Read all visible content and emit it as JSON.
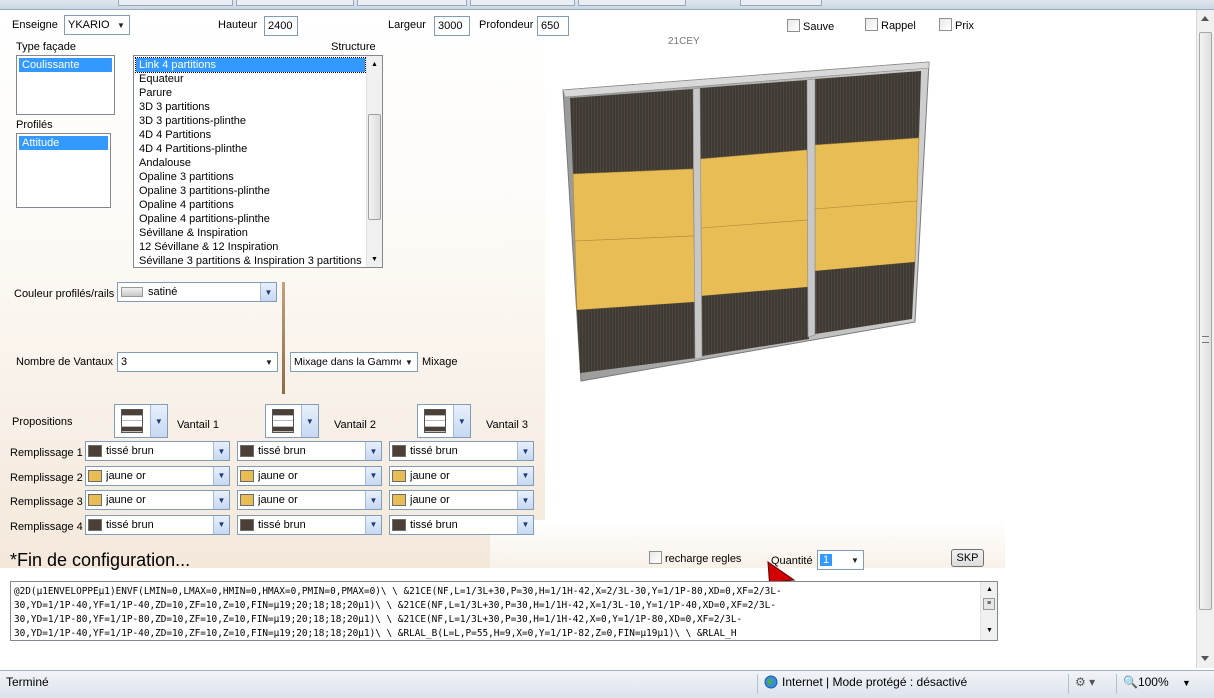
{
  "window": {
    "top_strip": "tabs"
  },
  "header": {
    "enseigne_label": "Enseigne",
    "enseigne_value": "YKARIO",
    "hauteur_label": "Hauteur",
    "hauteur_value": "2400",
    "largeur_label": "Largeur",
    "largeur_value": "3000",
    "profondeur_label": "Profondeur",
    "profondeur_value": "650",
    "sauve_label": "Sauve",
    "rappel_label": "Rappel",
    "prix_label": "Prix",
    "reference": "21CEY"
  },
  "type_facade": {
    "label": "Type façade",
    "items": [
      "Coulissante"
    ],
    "selected": "Coulissante"
  },
  "profiles": {
    "label": "Profilés",
    "items": [
      "Attitude"
    ],
    "selected": "Attitude"
  },
  "structure": {
    "label": "Structure",
    "items": [
      "Link 4 partitions",
      "Equateur",
      "Parure",
      "3D 3 partitions",
      "3D 3 partitions-plinthe",
      "4D 4 Partitions",
      "4D 4 Partitions-plinthe",
      "Andalouse",
      "Opaline 3 partitions",
      "Opaline 3 partitions-plinthe",
      "Opaline 4 partitions",
      "Opaline 4 partitions-plinthe",
      "Sévillane & Inspiration",
      "12 Sévillane & 12 Inspiration",
      "Sévillane 3 partitions & Inspiration 3 partitions"
    ]
  },
  "couleur": {
    "label": "Couleur profilés/rails",
    "value": "satiné"
  },
  "vantaux": {
    "label": "Nombre de Vantaux",
    "value": "3",
    "mixage_select": "Mixage dans la Gamme",
    "mixage_label": "Mixage"
  },
  "propositions": {
    "label": "Propositions",
    "vantaux": [
      "Vantail 1",
      "Vantail 2",
      "Vantail 3"
    ]
  },
  "remplissage": {
    "rows": [
      {
        "label": "Remplissage 1",
        "values": [
          "tissé brun",
          "tissé brun",
          "tissé brun"
        ],
        "colors": [
          "#4a4037",
          "#4a4037",
          "#4a4037"
        ]
      },
      {
        "label": "Remplissage 2",
        "values": [
          "jaune or",
          "jaune or",
          "jaune or"
        ],
        "colors": [
          "#e8bd55",
          "#e8bd55",
          "#e8bd55"
        ]
      },
      {
        "label": "Remplissage 3",
        "values": [
          "jaune or",
          "jaune or",
          "jaune or"
        ],
        "colors": [
          "#e8bd55",
          "#e8bd55",
          "#e8bd55"
        ]
      },
      {
        "label": "Remplissage 4",
        "values": [
          "tissé brun",
          "tissé brun",
          "tissé brun"
        ],
        "colors": [
          "#4a4037",
          "#4a4037",
          "#4a4037"
        ]
      }
    ]
  },
  "footer": {
    "fin": "*Fin de configuration...",
    "recharge_label": "recharge regles",
    "quantite_label": "Quantité",
    "quantite_value": "1",
    "skp_label": "SKP"
  },
  "code_lines": [
    "@2D(µ1ENVELOPPEµ1)ENVF(LMIN=0,LMAX=0,HMIN=0,HMAX=0,PMIN=0,PMAX=0)\\ \\ &21CE(NF,L=1/3L+30,P=30,H=1/1H-42,X=2/3L-30,Y=1/1P-80,XD=0,XF=2/3L-",
    "30,YD=1/1P-40,YF=1/1P-40,ZD=10,ZF=10,Z=10,FIN=µ19;20;18;18;20µ1)\\ \\ &21CE(NF,L=1/3L+30,P=30,H=1/1H-42,X=1/3L-10,Y=1/1P-40,XD=0,XF=2/3L-",
    "30,YD=1/1P-80,YF=1/1P-80,ZD=10,ZF=10,Z=10,FIN=µ19;20;18;18;20µ1)\\ \\ &21CE(NF,L=1/3L+30,P=30,H=1/1H-42,X=0,Y=1/1P-80,XD=0,XF=2/3L-",
    "30,YD=1/1P-40,YF=1/1P-40,ZD=10,ZF=10,Z=10,FIN=µ19;20;18;18;20µ1)\\ \\ &RLAL_B(L=L,P=55,H=9,X=0,Y=1/1P-82,Z=0,FIN=µ19µ1)\\ \\ &RLAL_H"
  ],
  "statusbar": {
    "left": "Terminé",
    "zone": "Internet | Mode protégé : désactivé",
    "zoom": "100%"
  },
  "colors": {
    "selection": "#3399ff",
    "brown": "#4a4037",
    "gold": "#e8bd55",
    "frame": "#b4b4b4"
  }
}
